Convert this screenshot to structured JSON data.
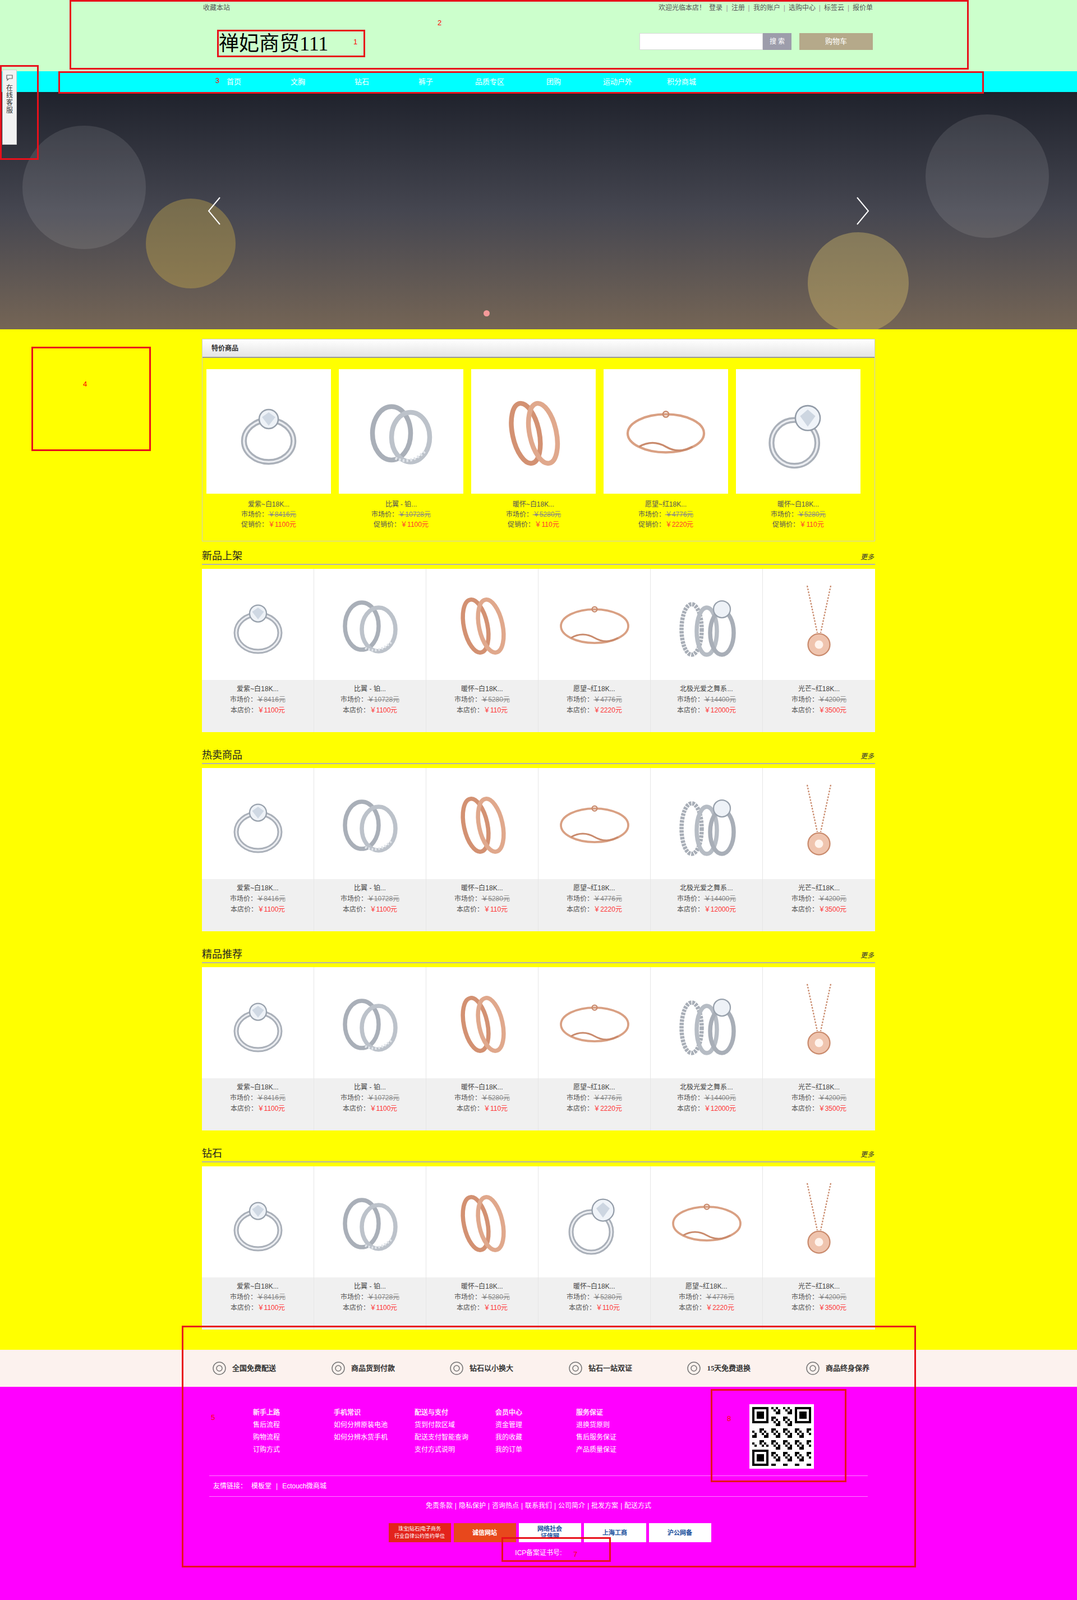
{
  "header": {
    "bookmark": "收藏本站",
    "welcome": "欢迎光临本店！",
    "links": [
      "登录",
      "注册",
      "我的账户",
      "选购中心",
      "标签云",
      "报价单"
    ],
    "separator": "|",
    "logo": "禅妃商贸111",
    "search_button": "搜 索",
    "cart": "购物车"
  },
  "nav": [
    "首页",
    "文胸",
    "钻石",
    "裤子",
    "品质专区",
    "团购",
    "运动户外",
    "积分商城"
  ],
  "customer_service": "在线客服",
  "banner": {
    "dots": [
      {
        "selected": true
      }
    ]
  },
  "featured": {
    "title": "特价商品",
    "market_label": "市场价：",
    "price_label": "促销价：",
    "products": [
      {
        "name": "爱紫~白18K...",
        "market_price": "￥8416元",
        "price": "￥1100元",
        "kind": "solitaire"
      },
      {
        "name": "比翼 - 铂...",
        "market_price": "￥10728元",
        "price": "￥1100元",
        "kind": "pair"
      },
      {
        "name": "暖怀~白18K...",
        "market_price": "￥5280元",
        "price": "￥110元",
        "kind": "rose"
      },
      {
        "name": "愿望~红18K...",
        "market_price": "￥4776元",
        "price": "￥2220元",
        "kind": "bracelet"
      },
      {
        "name": "暖怀~白18K...",
        "market_price": "￥5280元",
        "price": "￥110元",
        "kind": "halo"
      }
    ]
  },
  "section_labels": {
    "market": "市场价：",
    "price": "本店价："
  },
  "sections": [
    {
      "title": "新品上架",
      "more": "更多",
      "products": [
        {
          "name": "爱紫~白18K...",
          "market_price": "￥8416元",
          "price": "￥1100元",
          "kind": "solitaire"
        },
        {
          "name": "比翼 - 铂...",
          "market_price": "￥10728元",
          "price": "￥1100元",
          "kind": "pair"
        },
        {
          "name": "暖怀~白18K...",
          "market_price": "￥5280元",
          "price": "￥110元",
          "kind": "rose"
        },
        {
          "name": "愿望~红18K...",
          "market_price": "￥4776元",
          "price": "￥2220元",
          "kind": "bracelet"
        },
        {
          "name": "北极光爱之舞系...",
          "market_price": "￥14400元",
          "price": "￥12000元",
          "kind": "set"
        },
        {
          "name": "光芒~红18K...",
          "market_price": "￥4200元",
          "price": "￥3500元",
          "kind": "necklace"
        }
      ]
    },
    {
      "title": "热卖商品",
      "more": "更多",
      "products": [
        {
          "name": "爱紫~白18K...",
          "market_price": "￥8416元",
          "price": "￥1100元",
          "kind": "solitaire"
        },
        {
          "name": "比翼 - 铂...",
          "market_price": "￥10728元",
          "price": "￥1100元",
          "kind": "pair"
        },
        {
          "name": "暖怀~白18K...",
          "market_price": "￥5280元",
          "price": "￥110元",
          "kind": "rose"
        },
        {
          "name": "愿望~红18K...",
          "market_price": "￥4776元",
          "price": "￥2220元",
          "kind": "bracelet"
        },
        {
          "name": "北极光爱之舞系...",
          "market_price": "￥14400元",
          "price": "￥12000元",
          "kind": "set"
        },
        {
          "name": "光芒~红18K...",
          "market_price": "￥4200元",
          "price": "￥3500元",
          "kind": "necklace"
        }
      ]
    },
    {
      "title": "精品推荐",
      "more": "更多",
      "products": [
        {
          "name": "爱紫~白18K...",
          "market_price": "￥8416元",
          "price": "￥1100元",
          "kind": "solitaire"
        },
        {
          "name": "比翼 - 铂...",
          "market_price": "￥10728元",
          "price": "￥1100元",
          "kind": "pair"
        },
        {
          "name": "暖怀~白18K...",
          "market_price": "￥5280元",
          "price": "￥110元",
          "kind": "rose"
        },
        {
          "name": "愿望~红18K...",
          "market_price": "￥4776元",
          "price": "￥2220元",
          "kind": "bracelet"
        },
        {
          "name": "北极光爱之舞系...",
          "market_price": "￥14400元",
          "price": "￥12000元",
          "kind": "set"
        },
        {
          "name": "光芒~红18K...",
          "market_price": "￥4200元",
          "price": "￥3500元",
          "kind": "necklace"
        }
      ]
    },
    {
      "title": "钻石",
      "more": "更多",
      "products": [
        {
          "name": "爱紫~白18K...",
          "market_price": "￥8416元",
          "price": "￥1100元",
          "kind": "solitaire"
        },
        {
          "name": "比翼 - 铂...",
          "market_price": "￥10728元",
          "price": "￥1100元",
          "kind": "pair"
        },
        {
          "name": "暖怀~白18K...",
          "market_price": "￥5280元",
          "price": "￥110元",
          "kind": "rose"
        },
        {
          "name": "暖怀~白18K...",
          "market_price": "￥5280元",
          "price": "￥110元",
          "kind": "halo"
        },
        {
          "name": "愿望~红18K...",
          "market_price": "￥4776元",
          "price": "￥2220元",
          "kind": "bracelet"
        },
        {
          "name": "光芒~红18K...",
          "market_price": "￥4200元",
          "price": "￥3500元",
          "kind": "necklace"
        }
      ]
    }
  ],
  "services": [
    "全国免费配送",
    "商品货到付款",
    "钻石以小换大",
    "钻石一站双证",
    "15天免费退换",
    "商品终身保养"
  ],
  "footer": {
    "help": [
      {
        "title": "新手上路",
        "items": [
          "售后流程",
          "购物流程",
          "订购方式"
        ]
      },
      {
        "title": "手机常识",
        "items": [
          "如何分辨原装电池",
          "如何分辨水货手机"
        ]
      },
      {
        "title": "配送与支付",
        "items": [
          "货到付款区域",
          "配送支付智能查询",
          "支付方式说明"
        ]
      },
      {
        "title": "会员中心",
        "items": [
          "资金管理",
          "我的收藏",
          "我的订单"
        ]
      },
      {
        "title": "服务保证",
        "items": [
          "退换货原则",
          "售后服务保证",
          "产品质量保证"
        ]
      }
    ],
    "friend_label": "友情链接：",
    "friend_links": [
      "模板堂",
      "Ectouch微商城"
    ],
    "separator": "|",
    "links": [
      "免责条款",
      "隐私保护",
      "咨询热点",
      "联系我们",
      "公司简介",
      "批发方案",
      "配送方式"
    ],
    "badges": [
      {
        "lines": [
          "珠宝|钻石|电子商务",
          "行业自律公约签约单位"
        ],
        "kind": "red"
      },
      {
        "lines": [
          "诚信网站"
        ],
        "kind": "orange"
      },
      {
        "lines": [
          "网络社会",
          "证信网"
        ],
        "kind": "white"
      },
      {
        "lines": [
          "上海工商"
        ],
        "kind": "white"
      },
      {
        "lines": [
          "沪公网备"
        ],
        "kind": "white"
      }
    ],
    "icp": "ICP备案证书号:"
  },
  "annotations": [
    {
      "label": "1"
    },
    {
      "label": "2"
    },
    {
      "label": "3"
    },
    {
      "label": "4"
    },
    {
      "label": "5"
    },
    {
      "label": "7"
    },
    {
      "label": "8"
    }
  ]
}
